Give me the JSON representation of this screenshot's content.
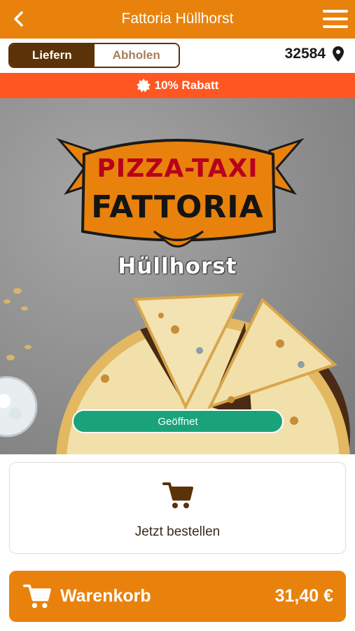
{
  "header": {
    "title": "Fattoria Hüllhorst",
    "back_icon": "chevron-left-icon",
    "menu_icon": "hamburger-menu-icon"
  },
  "mode_toggle": {
    "options": [
      {
        "label": "Liefern",
        "active": true
      },
      {
        "label": "Abholen",
        "active": false
      }
    ]
  },
  "location": {
    "zip": "32584",
    "icon": "map-pin-icon"
  },
  "discount": {
    "icon": "badge-star-icon",
    "label": "10% Rabatt"
  },
  "hero": {
    "logo_top": "PIZZA-TAXI",
    "logo_main": "FATTORIA",
    "logo_city": "Hüllhorst",
    "status": "Geöffnet"
  },
  "order_card": {
    "icon": "cart-icon",
    "label": "Jetzt bestellen"
  },
  "cart_bar": {
    "icon": "cart-icon",
    "label": "Warenkorb",
    "total": "31,40 €"
  },
  "colors": {
    "brand_orange": "#e8820c",
    "dark_brown": "#5c3208",
    "discount_red": "#ff5722",
    "status_green": "#1aa37a"
  }
}
